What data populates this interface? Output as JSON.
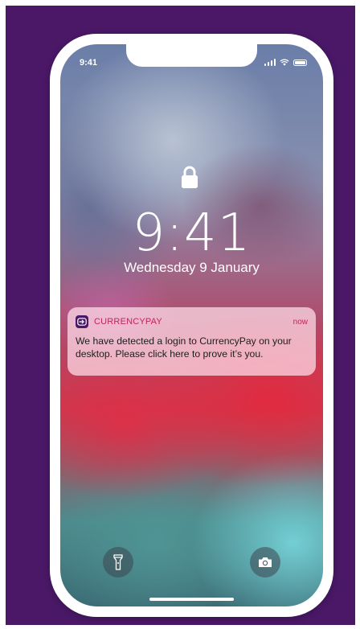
{
  "status_bar": {
    "time": "9:41"
  },
  "lock_screen": {
    "time": "9:41",
    "date": "Wednesday 9 January"
  },
  "notification": {
    "app_name": "CURRENCYPAY",
    "time": "now",
    "message": "We have detected a login to CurrencyPay on your desktop. Please click here to prove it’s you.",
    "app_icon": "login-arrow-icon"
  },
  "quick_actions": {
    "left_icon": "flashlight-icon",
    "right_icon": "camera-icon"
  },
  "colors": {
    "background": "#4a1867",
    "accent": "#c2235a",
    "device_frame": "#ffffff"
  }
}
